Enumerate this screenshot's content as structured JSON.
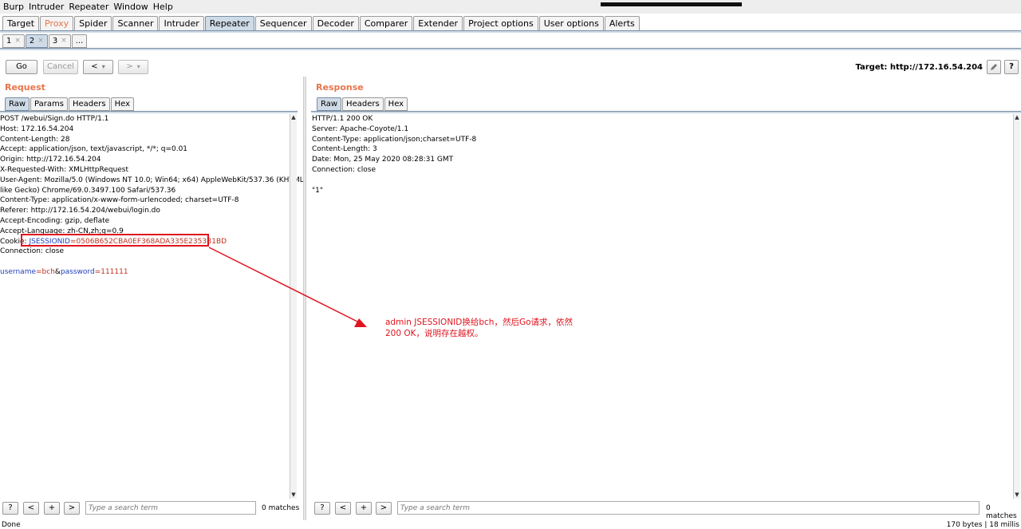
{
  "menu": [
    "Burp",
    "Intruder",
    "Repeater",
    "Window",
    "Help"
  ],
  "main_tabs": [
    "Target",
    "Proxy",
    "Spider",
    "Scanner",
    "Intruder",
    "Repeater",
    "Sequencer",
    "Decoder",
    "Comparer",
    "Extender",
    "Project options",
    "User options",
    "Alerts"
  ],
  "sub_tabs": [
    {
      "label": "1",
      "close": "×"
    },
    {
      "label": "2",
      "close": "×"
    },
    {
      "label": "3",
      "close": "×"
    },
    {
      "label": "..."
    }
  ],
  "toolbar": {
    "go": "Go",
    "cancel": "Cancel",
    "back": "<",
    "back_menu": "▾",
    "forward": ">",
    "forward_menu": "▾",
    "target_label": "Target: http://172.16.54.204",
    "edit_icon": "pencil-icon",
    "help": "?"
  },
  "request": {
    "title": "Request",
    "tabs": [
      "Raw",
      "Params",
      "Headers",
      "Hex"
    ],
    "lines": [
      "POST /webui/Sign.do HTTP/1.1",
      "Host: 172.16.54.204",
      "Content-Length: 28",
      "Accept: application/json, text/javascript, */*; q=0.01",
      "Origin: http://172.16.54.204",
      "X-Requested-With: XMLHttpRequest",
      "User-Agent: Mozilla/5.0 (Windows NT 10.0; Win64; x64) AppleWebKit/537.36 (KHTML,",
      "like Gecko) Chrome/69.0.3497.100 Safari/537.36",
      "Content-Type: application/x-www-form-urlencoded; charset=UTF-8",
      "Referer: http://172.16.54.204/webui/login.do",
      "Accept-Encoding: gzip, deflate",
      "Accept-Language: zh-CN,zh;q=0.9"
    ],
    "cookie_prefix": "Cookie: ",
    "cookie_name": "JSESSIONID",
    "cookie_eq": "=",
    "cookie_value": "0506B652CBA0EF368ADA335E2353B1BD",
    "connection": "Connection: close",
    "body": {
      "k1": "username",
      "v1": "bch",
      "amp": "&",
      "k2": "password",
      "v2": "111111",
      "eq": "="
    },
    "search_placeholder": "Type a search term",
    "matches": "0 matches"
  },
  "response": {
    "title": "Response",
    "tabs": [
      "Raw",
      "Headers",
      "Hex"
    ],
    "lines": [
      "HTTP/1.1 200 OK",
      "Server: Apache-Coyote/1.1",
      "Content-Type: application/json;charset=UTF-8",
      "Content-Length: 3",
      "Date: Mon, 25 May 2020 08:28:31 GMT",
      "Connection: close",
      "",
      "\"1\""
    ],
    "search_placeholder": "Type a search term",
    "matches": "0 matches"
  },
  "search_buttons": [
    "?",
    "<",
    "+",
    ">"
  ],
  "annotation": "admin  JSESSIONID换给bch，然后Go请求，依然200 OK，说明存在越权。",
  "status": {
    "left": "Done",
    "right": "170 bytes | 18 millis"
  },
  "colors": {
    "accent": "#e8744b",
    "annotation": "#e0141e",
    "key": "#1f3fbf",
    "value": "#c03020"
  }
}
